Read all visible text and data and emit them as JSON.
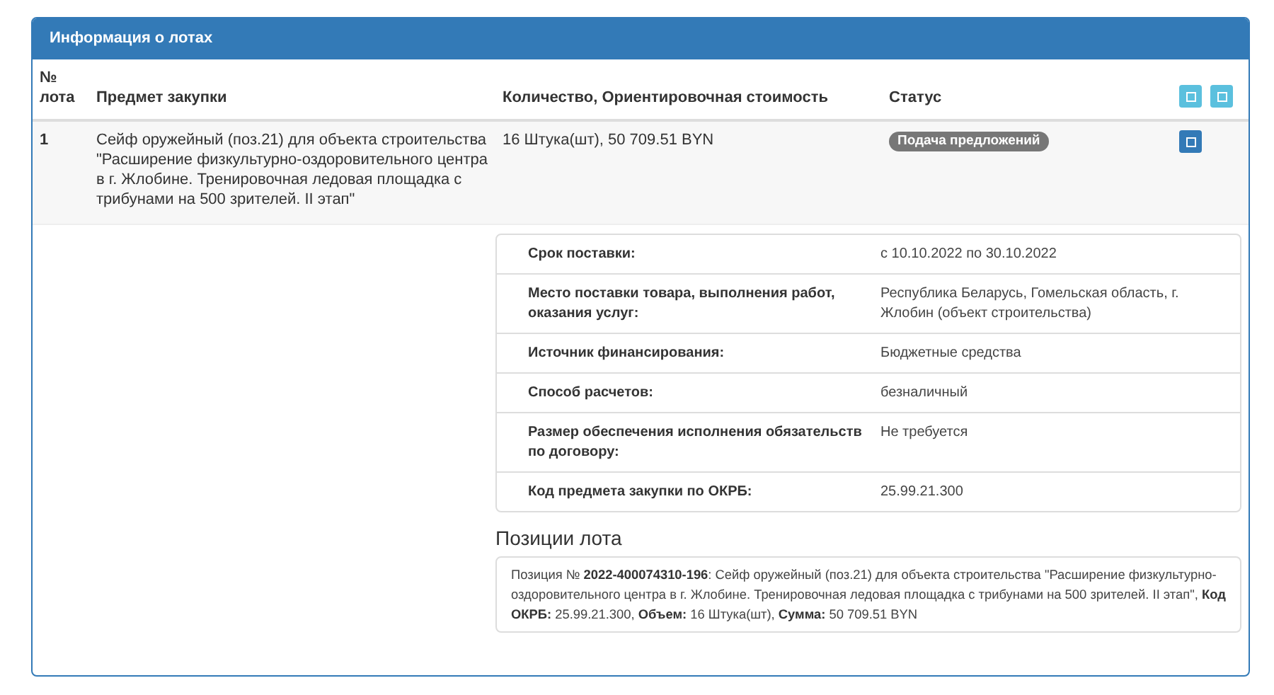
{
  "panel": {
    "title": "Информация о лотах"
  },
  "table": {
    "columns": [
      "№ лота",
      "Предмет закупки",
      "Количество, Ориентировочная стоимость",
      "Статус"
    ],
    "header_buttons": [
      {
        "kind": "square"
      },
      {
        "kind": "square"
      }
    ],
    "rows": [
      {
        "number": "1",
        "subject": "Сейф оружейный (поз.21) для объекта строительства \"Расширение физкультурно-оздоровительного центра в г. Жлобине. Тренировочная ледовая площадка с трибунами на 500 зрителей. II этап\"",
        "quantity": "16 Штука(шт), 50 709.51 BYN",
        "status": "Подача предложений"
      }
    ]
  },
  "details": [
    {
      "label": "Срок поставки:",
      "value": "с 10.10.2022 по 30.10.2022"
    },
    {
      "label": "Место поставки товара, выполнения работ, оказания услуг:",
      "value": "Республика Беларусь, Гомельская область, г. Жлобин (объект строительства)"
    },
    {
      "label": "Источник финансирования:",
      "value": "Бюджетные средства"
    },
    {
      "label": "Способ расчетов:",
      "value": "безналичный"
    },
    {
      "label": "Размер обеспечения исполнения обязательств по договору:",
      "value": "Не требуется"
    },
    {
      "label": "Код предмета закупки по ОКРБ:",
      "value": "25.99.21.300"
    }
  ],
  "positions": {
    "title": "Позиции лота",
    "items": [
      "Позиция № **2022-400074310-196**: Сейф оружейный (поз.21) для объекта строительства \"Расширение физкультурно-оздоровительного центра в г. Жлобине. Тренировочная ледовая площадка с трибунами на 500 зрителей. II этап\", **Код ОКРБ:** 25.99.21.300, **Объем:** 16 Штука(шт), **Сумма:** 50 709.51 BYN"
    ]
  }
}
